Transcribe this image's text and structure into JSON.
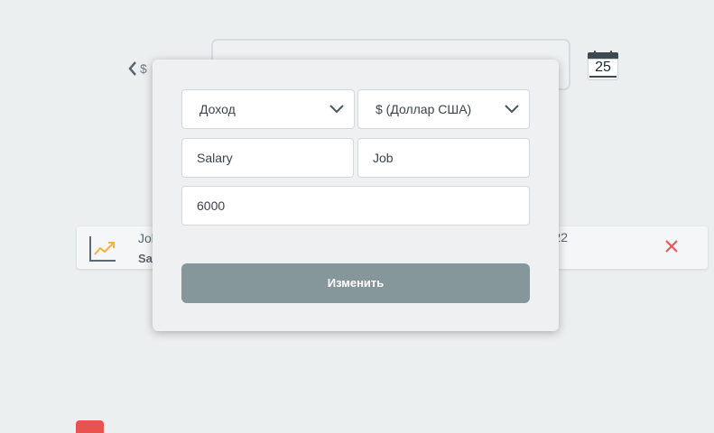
{
  "header": {
    "back_label": "$",
    "search_placeholder": "",
    "calendar_day": "25"
  },
  "transaction": {
    "note": "Job",
    "category": "Sa",
    "date_fragment": "22"
  },
  "modal": {
    "type_value": "Доход",
    "currency_value": "$ (Доллар США)",
    "category_value": "Salary",
    "note_value": "Job",
    "amount_value": "6000",
    "submit_label": "Изменить"
  },
  "colors": {
    "background": "#eceff0",
    "submit": "#86979c",
    "delete": "#e9534f",
    "chart_accent": "#f3b23b"
  }
}
